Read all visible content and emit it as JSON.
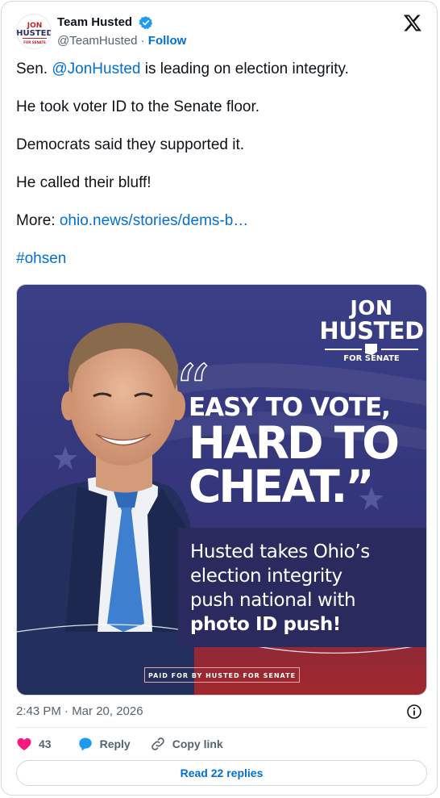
{
  "author": {
    "name": "Team Husted",
    "handle": "@TeamHusted",
    "separator": "·",
    "follow_label": "Follow",
    "avatar_text": {
      "line1": "JON",
      "line2": "HUSTED",
      "line3": "FOR SENATE"
    }
  },
  "tweet": {
    "line1_prefix": "Sen. ",
    "line1_mention": "@JonHusted",
    "line1_suffix": " is leading on election integrity.",
    "line2": "He took voter ID to the Senate floor.",
    "line3": "Democrats said they supported it.",
    "line4": "He called their bluff!",
    "more_label": "More: ",
    "more_link": "ohio.news/stories/dems-b…",
    "hashtag": "#ohsen"
  },
  "media": {
    "logo_jon": "JON",
    "logo_husted": "HUSTED",
    "logo_for": "FOR SENATE",
    "headline_1": "EASY TO VOTE,",
    "headline_2": "HARD TO",
    "headline_3": "CHEAT.”",
    "sub_1": "Husted takes Ohio’s",
    "sub_2": "election integrity",
    "sub_3": "push national with",
    "sub_4": "photo ID push!",
    "paid_for": "PAID FOR BY HUSTED FOR SENATE"
  },
  "footer": {
    "timestamp": "2:43 PM · Mar 20, 2026",
    "like_count": "43",
    "reply_label": "Reply",
    "copy_link_label": "Copy link",
    "read_replies_label": "Read 22 replies"
  },
  "colors": {
    "link": "#006fd6",
    "like": "#f91880",
    "verified": "#1d9bf0",
    "ad_navy": "#2a2a5e",
    "ad_red": "#a02a2a"
  }
}
